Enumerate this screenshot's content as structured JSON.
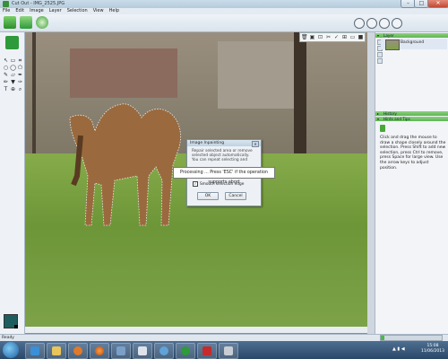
{
  "window": {
    "title": "Cut Out - IMG_2525.JPG"
  },
  "menu": [
    "File",
    "Edit",
    "Image",
    "Layer",
    "Selection",
    "View",
    "Help"
  ],
  "toolbar": {
    "icons": [
      "open-icon",
      "save-icon",
      "help-icon"
    ]
  },
  "dialog": {
    "title": "Image Inpainting",
    "message": "Repair selected area or remove selected object automatically. You can repeat selecting and",
    "checkbox_label": "Smooth selection edge",
    "checked": true,
    "ok_label": "OK",
    "cancel_label": "Cancel"
  },
  "processing": {
    "text": "Processing ... Press 'ESC' if the operation supports abort"
  },
  "layers": {
    "header": "Layer",
    "items": [
      "Background"
    ]
  },
  "history": {
    "header": "History"
  },
  "hints": {
    "header": "Hints and Tips",
    "text": "Click and drag the mouse to draw a shape closely around the selection. Press Shift to add new selection, press Ctrl to remove, press Space for large view. Use the arrow keys to adjust position."
  },
  "status": {
    "text": "Ready",
    "progress_fraction": 0.06
  },
  "taskbar": {
    "time": "15:08",
    "date": "11/06/2013"
  }
}
